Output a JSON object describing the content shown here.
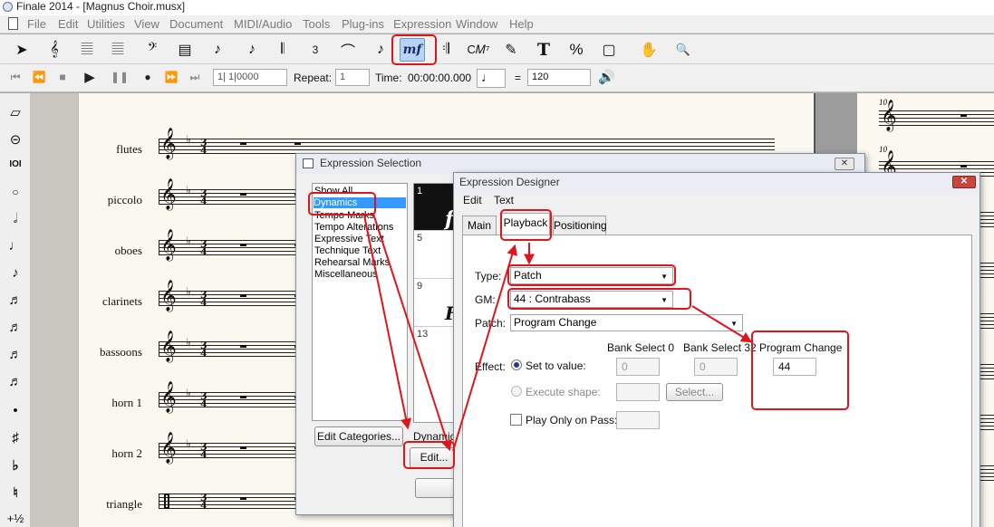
{
  "app": {
    "title": "Finale 2014 - [Magnus Choir.musx]"
  },
  "menu": [
    "File",
    "Edit",
    "Utilities",
    "View",
    "Document",
    "MIDI/Audio",
    "Tools",
    "Plug-ins",
    "Expression",
    "Window",
    "Help"
  ],
  "toolbar": {
    "tools": [
      {
        "name": "selection-tool",
        "glyph": "➤"
      },
      {
        "name": "staff-tool",
        "glyph": "𝄞"
      },
      {
        "name": "simple-entry-tool",
        "glyph": "𝄚"
      },
      {
        "name": "speedy-entry-tool",
        "glyph": "𝄚"
      },
      {
        "name": "clef-tool",
        "glyph": "𝄢"
      },
      {
        "name": "measure-tool",
        "glyph": "▤"
      },
      {
        "name": "note-tool",
        "glyph": "♪"
      },
      {
        "name": "articulation-tool",
        "glyph": "♪"
      },
      {
        "name": "smart-shape-tool",
        "glyph": "𝄃"
      },
      {
        "name": "tuplet-tool",
        "glyph": "3"
      },
      {
        "name": "slur-tool",
        "glyph": "⌒"
      },
      {
        "name": "lyrics-tool",
        "glyph": "♪"
      },
      {
        "name": "expression-tool",
        "glyph": "mf"
      },
      {
        "name": "repeat-tool",
        "glyph": "𝄇"
      },
      {
        "name": "chord-tool",
        "glyph": "C𝑀⁷"
      },
      {
        "name": "mirror-tool",
        "glyph": "✎"
      },
      {
        "name": "text-tool",
        "glyph": "T"
      },
      {
        "name": "resize-tool",
        "glyph": "%"
      },
      {
        "name": "page-layout-tool",
        "glyph": "▢"
      },
      {
        "name": "hand-grabber-tool",
        "glyph": "✋"
      },
      {
        "name": "zoom-tool",
        "glyph": "🔍"
      }
    ]
  },
  "playback": {
    "counter": "1| 1|0000",
    "repeat_label": "Repeat:",
    "repeat_value": "1",
    "time_label": "Time:",
    "time_value": "00:00:00.000",
    "tempo_equals": "=",
    "tempo_value": "120"
  },
  "score": {
    "instruments": [
      "flutes",
      "piccolo",
      "oboes",
      "clarinets",
      "bassoons",
      "horn 1",
      "horn 2",
      "triangle"
    ],
    "measure_numbers": [
      "10",
      "10"
    ]
  },
  "left_palette": [
    {
      "name": "eraser-icon",
      "glyph": "▱"
    },
    {
      "name": "hold-note-icon",
      "glyph": "⊝"
    },
    {
      "name": "voice-icon",
      "glyph": "IOI"
    },
    {
      "name": "whole-note-icon",
      "glyph": "○"
    },
    {
      "name": "half-note-icon",
      "glyph": "𝅗𝅥"
    },
    {
      "name": "quarter-note-icon",
      "glyph": "♩"
    },
    {
      "name": "eighth-note-icon",
      "glyph": "♪"
    },
    {
      "name": "sixteenth-note-icon",
      "glyph": "♬"
    },
    {
      "name": "thirty-second-note-icon",
      "glyph": "♬"
    },
    {
      "name": "sixty-fourth-note-icon",
      "glyph": "♬"
    },
    {
      "name": "hundred-twenty-eighth-note-icon",
      "glyph": "♬"
    },
    {
      "name": "dot-icon",
      "glyph": "•"
    },
    {
      "name": "sharp-icon",
      "glyph": "♯"
    },
    {
      "name": "flat-icon",
      "glyph": "♭"
    },
    {
      "name": "natural-icon",
      "glyph": "♮"
    },
    {
      "name": "half-step-up-icon",
      "glyph": "+½"
    }
  ],
  "expression_selection": {
    "title": "Expression Selection",
    "categories": [
      "Show All",
      "Dynamics",
      "Tempo Marks",
      "Tempo Alterations",
      "Expressive Text",
      "Technique Text",
      "Rehearsal Marks",
      "Miscellaneous"
    ],
    "selected_category": "Dynamics",
    "grid_numbers": [
      "1",
      "5",
      "9",
      "13"
    ],
    "grid_glyphs": [
      "f",
      "F"
    ],
    "edit_categories_label": "Edit Categories...",
    "category_label": "Dynamics",
    "edit_label": "Edit..."
  },
  "expression_designer": {
    "title": "Expression Designer",
    "menu": [
      "Edit",
      "Text"
    ],
    "tabs": [
      "Main",
      "Playback",
      "Positioning"
    ],
    "active_tab": "Playback",
    "type_label": "Type:",
    "type_value": "Patch",
    "gm_label": "GM:",
    "gm_value": "44 : Contrabass",
    "patch_label": "Patch:",
    "patch_value": "Program Change",
    "effect_label": "Effect:",
    "set_to_value_label": "Set to value:",
    "execute_shape_label": "Execute shape:",
    "play_only_on_pass_label": "Play Only on Pass:",
    "bank_select_0_label": "Bank Select 0",
    "bank_select_32_label": "Bank Select 32",
    "program_change_label": "Program Change",
    "bank_select_0_value": "0",
    "bank_select_32_value": "0",
    "program_change_value": "44",
    "select_button_label": "Select..."
  },
  "colors": {
    "highlight": "#e0151c",
    "selection": "#3399ff",
    "paper": "#fbf8ef"
  }
}
